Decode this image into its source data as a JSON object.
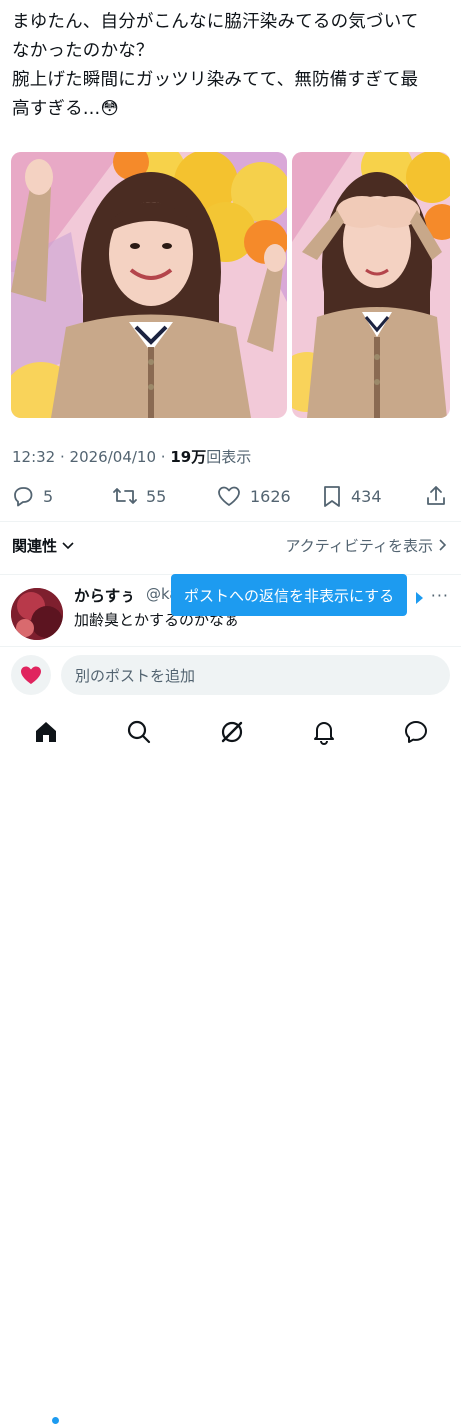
{
  "post": {
    "lines": [
      "まゆたん、自分がこんなに脇汗染みてるの気づいて",
      "なかったのかな？",
      "腕上げた瞬間にガッツリ染みてて、無防備すぎて最",
      "高すぎる…😳"
    ],
    "time": "12:32",
    "separator": " · ",
    "date": "2026/04/10",
    "views_sep": " · ",
    "views_count": "19万",
    "views_label": "回表示"
  },
  "actions": {
    "replies": "5",
    "reposts": "55",
    "likes": "1626",
    "bookmarks": "434"
  },
  "sort": {
    "label": "関連性",
    "activity_link": "アクティビティを表示"
  },
  "reply": {
    "name": "からすぅ",
    "handle": "@ka",
    "text": "加齢臭とかするのかなぁ",
    "more": "···"
  },
  "tooltip": {
    "text": "ポストへの返信を非表示にする"
  },
  "compose": {
    "placeholder": "別のポストを追加"
  },
  "colors": {
    "accent": "#1d9bf0",
    "text": "#0f1419",
    "secondary": "#536471",
    "like_heart": "#f91880"
  },
  "icons": {
    "reply": "reply-icon",
    "repost": "repost-icon",
    "like": "heart-icon",
    "bookmark": "bookmark-icon",
    "share": "share-icon",
    "home": "home-icon",
    "search": "search-icon",
    "grok": "grok-icon",
    "notifications": "bell-icon",
    "messages": "message-icon"
  }
}
